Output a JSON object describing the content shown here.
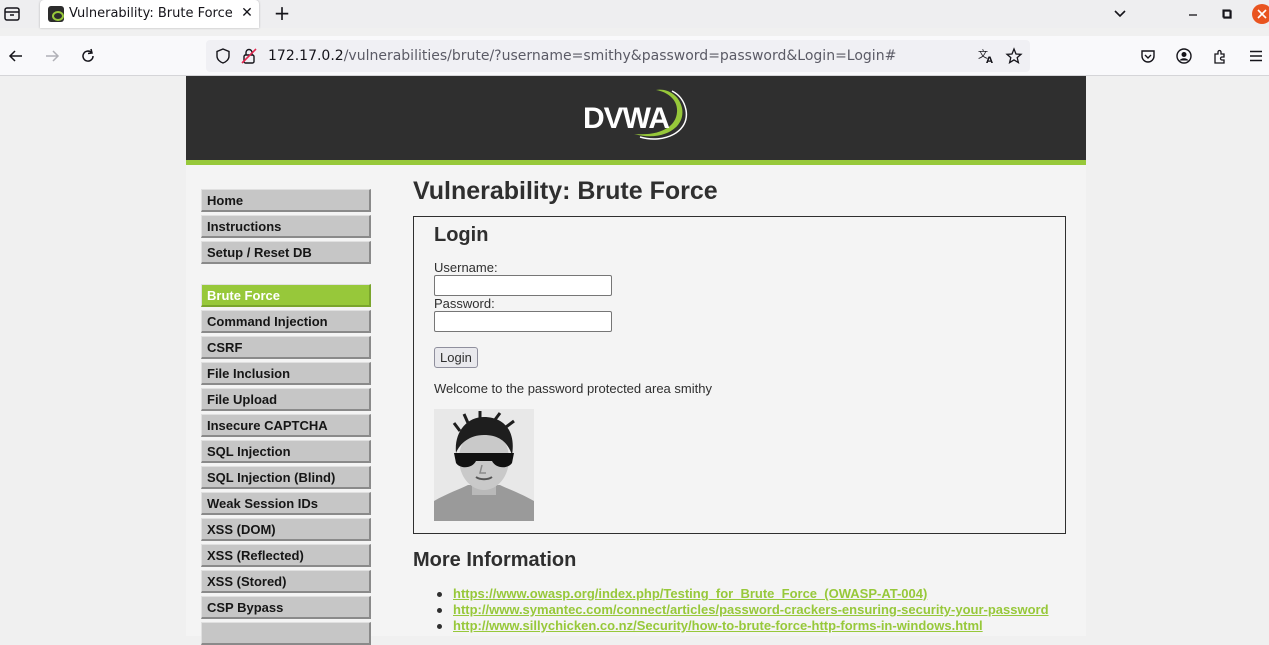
{
  "browser": {
    "tab_title": "Vulnerability: Brute Force",
    "url_host": "172.17.0.2",
    "url_path": "/vulnerabilities/brute/?username=smithy&password=password&Login=Login#",
    "close_tab_glyph": "✕",
    "new_tab_glyph": "+"
  },
  "header": {
    "logo_text": "DVWA",
    "accent_color": "#97c83a"
  },
  "menu": {
    "group1": [
      "Home",
      "Instructions",
      "Setup / Reset DB"
    ],
    "group2": [
      "Brute Force",
      "Command Injection",
      "CSRF",
      "File Inclusion",
      "File Upload",
      "Insecure CAPTCHA",
      "SQL Injection",
      "SQL Injection (Blind)",
      "Weak Session IDs",
      "XSS (DOM)",
      "XSS (Reflected)",
      "XSS (Stored)",
      "CSP Bypass"
    ],
    "active": "Brute Force"
  },
  "main": {
    "title": "Vulnerability: Brute Force",
    "login": {
      "heading": "Login",
      "username_label": "Username:",
      "username_value": "",
      "password_label": "Password:",
      "password_value": "",
      "button_label": "Login",
      "welcome_text": "Welcome to the password protected area smithy"
    },
    "more_info": {
      "heading": "More Information",
      "links": [
        "https://www.owasp.org/index.php/Testing_for_Brute_Force_(OWASP-AT-004)",
        "http://www.symantec.com/connect/articles/password-crackers-ensuring-security-your-password",
        "http://www.sillychicken.co.nz/Security/how-to-brute-force-http-forms-in-windows.html"
      ]
    }
  }
}
